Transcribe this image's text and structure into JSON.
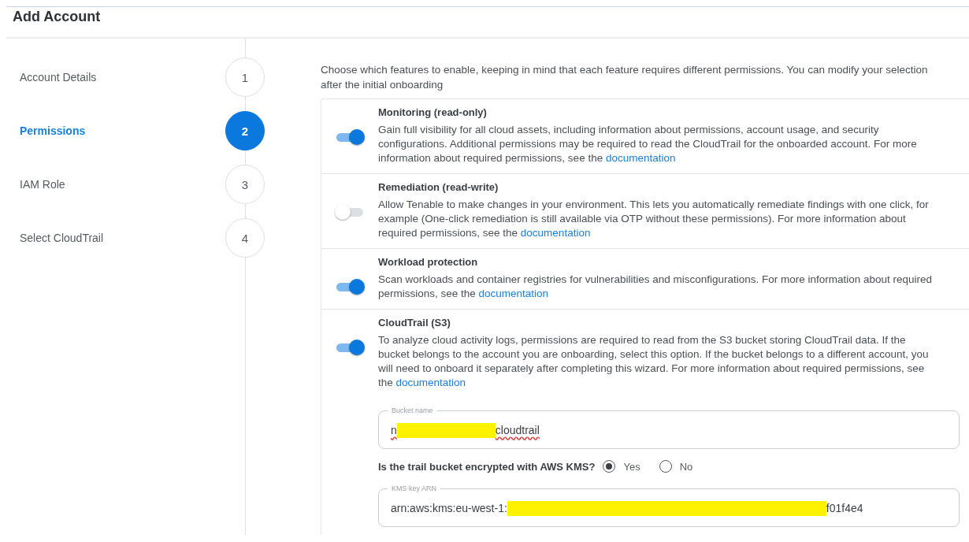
{
  "title": "Add Account",
  "steps": [
    {
      "label": "Account Details",
      "number": "1",
      "selected": false
    },
    {
      "label": "Permissions",
      "number": "2",
      "selected": true
    },
    {
      "label": "IAM Role",
      "number": "3",
      "selected": false
    },
    {
      "label": "Select CloudTrail",
      "number": "4",
      "selected": false
    }
  ],
  "intro": "Choose which features to enable, keeping in mind that each feature requires different permissions. You can modify your selection after the initial onboarding",
  "features": [
    {
      "title": "Monitoring (read-only)",
      "on": true,
      "description": "Gain full visibility for all cloud assets, including information about permissions, account usage, and security configurations. Additional permissions may be required to read the CloudTrail for the onboarded account. For more information about required permissions, see the",
      "link": "documentation"
    },
    {
      "title": "Remediation (read-write)",
      "on": false,
      "description": "Allow Tenable to make changes in your environment. This lets you automatically remediate findings with one click, for example (One-click remediation is still available via OTP without these permissions). For more information about required permissions, see the",
      "link": "documentation"
    },
    {
      "title": "Workload protection",
      "on": true,
      "description": "Scan workloads and container registries for vulnerabilities and misconfigurations. For more information about required permissions, see the",
      "link": "documentation"
    },
    {
      "title": "CloudTrail (S3)",
      "on": true,
      "description": "To analyze cloud activity logs, permissions are required to read from the S3 bucket storing CloudTrail data. If the bucket belongs to the account you are onboarding, select this option. If the bucket belongs to a different account, you will need to onboard it separately after completing this wizard. For more information about required permissions, see the",
      "link": "documentation",
      "bucket_field": {
        "label": "Bucket name",
        "value_start": "n",
        "value_end": "cloudtrail"
      },
      "question": "Is the trail bucket encrypted with AWS KMS?",
      "options": [
        {
          "label": "Yes",
          "selected": true
        },
        {
          "label": "No",
          "selected": false
        }
      ],
      "kms_field": {
        "label": "KMS key ARN",
        "value_start": "arn:aws:kms:eu-west-1:",
        "value_end": "f01f4e4"
      }
    }
  ]
}
